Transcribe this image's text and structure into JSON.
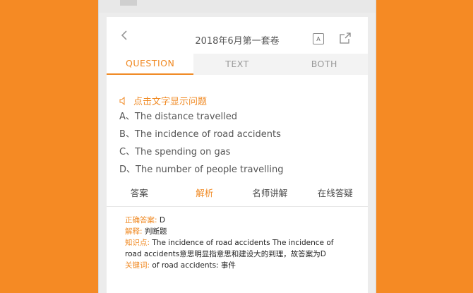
{
  "header": {
    "title": "2018年6月第一套卷"
  },
  "icons": {
    "back": "chevron-left-icon",
    "font": "font-size-icon",
    "share": "share-icon",
    "speaker": "speaker-icon"
  },
  "tabs": [
    "QUESTION",
    "TEXT",
    "BOTH"
  ],
  "question": {
    "prompt": "点击文字显示问题",
    "options": [
      "A、The distance travelled",
      "B、The incidence of road accidents",
      "C、The spending on gas",
      "D、The number of people travelling"
    ]
  },
  "answer_tabs": [
    "答案",
    "解析",
    "名师讲解",
    "在线答疑"
  ],
  "answer": {
    "correct_label": "正确答案:",
    "correct_value": "D",
    "analysis_label": "解释:",
    "analysis_value": "判断题",
    "knowledge_label": "知识点:",
    "knowledge_value": "The incidence of road accidents The incidence of road accidents意思明显指意思和建设大的到理，故答案为D",
    "key_label": "关键词:",
    "key_value": "of road accidents: 事件"
  },
  "colors": {
    "accent": "#f08a24",
    "background": "#f58a24"
  }
}
